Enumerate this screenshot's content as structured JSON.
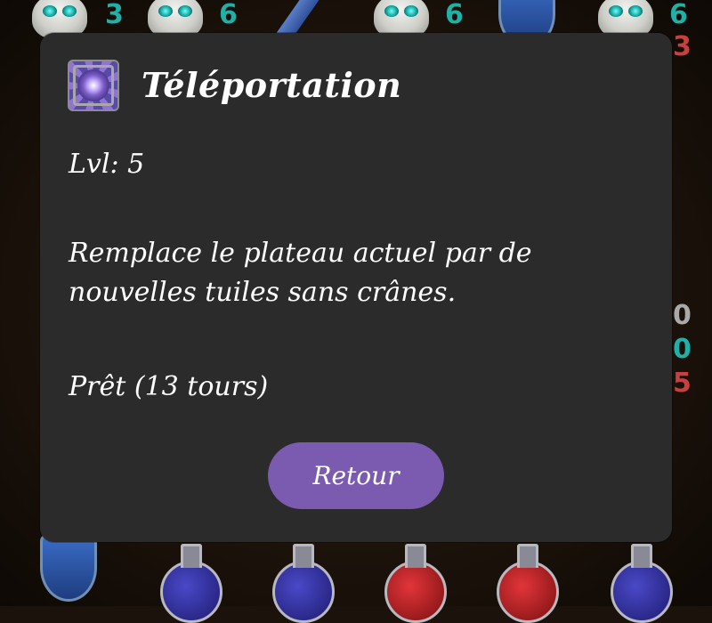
{
  "board": {
    "top_counts": [
      "3",
      "6",
      "6",
      "6"
    ],
    "side_counts": [
      "3",
      "0",
      "0",
      "5"
    ]
  },
  "dialog": {
    "icon": "teleport-vortex-icon",
    "title": "Téléportation",
    "level": "Lvl: 5",
    "description": "Remplace le plateau actuel par de nouvelles tuiles sans crânes.",
    "status": "Prêt (13 tours)",
    "back_label": "Retour"
  },
  "colors": {
    "dialog_bg": "#2b2b2b",
    "button": "#7a5bb0",
    "text": "#ffffff"
  }
}
